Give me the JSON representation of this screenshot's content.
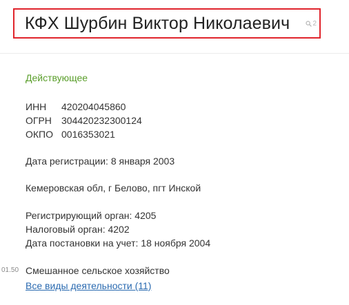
{
  "header": {
    "title": "КФХ Шурбин Виктор Николаевич",
    "search_count": "2"
  },
  "company": {
    "status": "Действующее",
    "identifiers": [
      {
        "label": "ИНН",
        "value": "420204045860"
      },
      {
        "label": "ОГРН",
        "value": "304420232300124"
      },
      {
        "label": "ОКПО",
        "value": "0016353021"
      }
    ],
    "registration_date": "Дата регистрации: 8 января 2003",
    "address": "Кемеровская обл, г Белово, пгт Инской",
    "registering_authority": "Регистрирующий орган: 4205",
    "tax_authority": "Налоговый орган: 4202",
    "registration_record_date": "Дата постановки на учет: 18 ноября 2004",
    "activity_code": "01.50",
    "activity_name": "Смешанное сельское хозяйство",
    "all_activities_link": "Все виды деятельности (11)"
  },
  "colors": {
    "highlight_border": "#e0242c",
    "status_green": "#5a9e2b",
    "link_blue": "#2a6ab0"
  }
}
